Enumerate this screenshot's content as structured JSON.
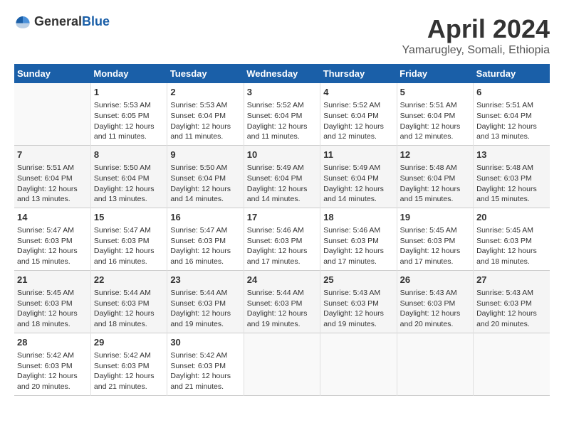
{
  "logo": {
    "general": "General",
    "blue": "Blue"
  },
  "title": "April 2024",
  "subtitle": "Yamarugley, Somali, Ethiopia",
  "days_header": [
    "Sunday",
    "Monday",
    "Tuesday",
    "Wednesday",
    "Thursday",
    "Friday",
    "Saturday"
  ],
  "weeks": [
    [
      {
        "day": "",
        "sunrise": "",
        "sunset": "",
        "daylight": ""
      },
      {
        "day": "1",
        "sunrise": "Sunrise: 5:53 AM",
        "sunset": "Sunset: 6:05 PM",
        "daylight": "Daylight: 12 hours and 11 minutes."
      },
      {
        "day": "2",
        "sunrise": "Sunrise: 5:53 AM",
        "sunset": "Sunset: 6:04 PM",
        "daylight": "Daylight: 12 hours and 11 minutes."
      },
      {
        "day": "3",
        "sunrise": "Sunrise: 5:52 AM",
        "sunset": "Sunset: 6:04 PM",
        "daylight": "Daylight: 12 hours and 11 minutes."
      },
      {
        "day": "4",
        "sunrise": "Sunrise: 5:52 AM",
        "sunset": "Sunset: 6:04 PM",
        "daylight": "Daylight: 12 hours and 12 minutes."
      },
      {
        "day": "5",
        "sunrise": "Sunrise: 5:51 AM",
        "sunset": "Sunset: 6:04 PM",
        "daylight": "Daylight: 12 hours and 12 minutes."
      },
      {
        "day": "6",
        "sunrise": "Sunrise: 5:51 AM",
        "sunset": "Sunset: 6:04 PM",
        "daylight": "Daylight: 12 hours and 13 minutes."
      }
    ],
    [
      {
        "day": "7",
        "sunrise": "Sunrise: 5:51 AM",
        "sunset": "Sunset: 6:04 PM",
        "daylight": "Daylight: 12 hours and 13 minutes."
      },
      {
        "day": "8",
        "sunrise": "Sunrise: 5:50 AM",
        "sunset": "Sunset: 6:04 PM",
        "daylight": "Daylight: 12 hours and 13 minutes."
      },
      {
        "day": "9",
        "sunrise": "Sunrise: 5:50 AM",
        "sunset": "Sunset: 6:04 PM",
        "daylight": "Daylight: 12 hours and 14 minutes."
      },
      {
        "day": "10",
        "sunrise": "Sunrise: 5:49 AM",
        "sunset": "Sunset: 6:04 PM",
        "daylight": "Daylight: 12 hours and 14 minutes."
      },
      {
        "day": "11",
        "sunrise": "Sunrise: 5:49 AM",
        "sunset": "Sunset: 6:04 PM",
        "daylight": "Daylight: 12 hours and 14 minutes."
      },
      {
        "day": "12",
        "sunrise": "Sunrise: 5:48 AM",
        "sunset": "Sunset: 6:04 PM",
        "daylight": "Daylight: 12 hours and 15 minutes."
      },
      {
        "day": "13",
        "sunrise": "Sunrise: 5:48 AM",
        "sunset": "Sunset: 6:03 PM",
        "daylight": "Daylight: 12 hours and 15 minutes."
      }
    ],
    [
      {
        "day": "14",
        "sunrise": "Sunrise: 5:47 AM",
        "sunset": "Sunset: 6:03 PM",
        "daylight": "Daylight: 12 hours and 15 minutes."
      },
      {
        "day": "15",
        "sunrise": "Sunrise: 5:47 AM",
        "sunset": "Sunset: 6:03 PM",
        "daylight": "Daylight: 12 hours and 16 minutes."
      },
      {
        "day": "16",
        "sunrise": "Sunrise: 5:47 AM",
        "sunset": "Sunset: 6:03 PM",
        "daylight": "Daylight: 12 hours and 16 minutes."
      },
      {
        "day": "17",
        "sunrise": "Sunrise: 5:46 AM",
        "sunset": "Sunset: 6:03 PM",
        "daylight": "Daylight: 12 hours and 17 minutes."
      },
      {
        "day": "18",
        "sunrise": "Sunrise: 5:46 AM",
        "sunset": "Sunset: 6:03 PM",
        "daylight": "Daylight: 12 hours and 17 minutes."
      },
      {
        "day": "19",
        "sunrise": "Sunrise: 5:45 AM",
        "sunset": "Sunset: 6:03 PM",
        "daylight": "Daylight: 12 hours and 17 minutes."
      },
      {
        "day": "20",
        "sunrise": "Sunrise: 5:45 AM",
        "sunset": "Sunset: 6:03 PM",
        "daylight": "Daylight: 12 hours and 18 minutes."
      }
    ],
    [
      {
        "day": "21",
        "sunrise": "Sunrise: 5:45 AM",
        "sunset": "Sunset: 6:03 PM",
        "daylight": "Daylight: 12 hours and 18 minutes."
      },
      {
        "day": "22",
        "sunrise": "Sunrise: 5:44 AM",
        "sunset": "Sunset: 6:03 PM",
        "daylight": "Daylight: 12 hours and 18 minutes."
      },
      {
        "day": "23",
        "sunrise": "Sunrise: 5:44 AM",
        "sunset": "Sunset: 6:03 PM",
        "daylight": "Daylight: 12 hours and 19 minutes."
      },
      {
        "day": "24",
        "sunrise": "Sunrise: 5:44 AM",
        "sunset": "Sunset: 6:03 PM",
        "daylight": "Daylight: 12 hours and 19 minutes."
      },
      {
        "day": "25",
        "sunrise": "Sunrise: 5:43 AM",
        "sunset": "Sunset: 6:03 PM",
        "daylight": "Daylight: 12 hours and 19 minutes."
      },
      {
        "day": "26",
        "sunrise": "Sunrise: 5:43 AM",
        "sunset": "Sunset: 6:03 PM",
        "daylight": "Daylight: 12 hours and 20 minutes."
      },
      {
        "day": "27",
        "sunrise": "Sunrise: 5:43 AM",
        "sunset": "Sunset: 6:03 PM",
        "daylight": "Daylight: 12 hours and 20 minutes."
      }
    ],
    [
      {
        "day": "28",
        "sunrise": "Sunrise: 5:42 AM",
        "sunset": "Sunset: 6:03 PM",
        "daylight": "Daylight: 12 hours and 20 minutes."
      },
      {
        "day": "29",
        "sunrise": "Sunrise: 5:42 AM",
        "sunset": "Sunset: 6:03 PM",
        "daylight": "Daylight: 12 hours and 21 minutes."
      },
      {
        "day": "30",
        "sunrise": "Sunrise: 5:42 AM",
        "sunset": "Sunset: 6:03 PM",
        "daylight": "Daylight: 12 hours and 21 minutes."
      },
      {
        "day": "",
        "sunrise": "",
        "sunset": "",
        "daylight": ""
      },
      {
        "day": "",
        "sunrise": "",
        "sunset": "",
        "daylight": ""
      },
      {
        "day": "",
        "sunrise": "",
        "sunset": "",
        "daylight": ""
      },
      {
        "day": "",
        "sunrise": "",
        "sunset": "",
        "daylight": ""
      }
    ]
  ]
}
